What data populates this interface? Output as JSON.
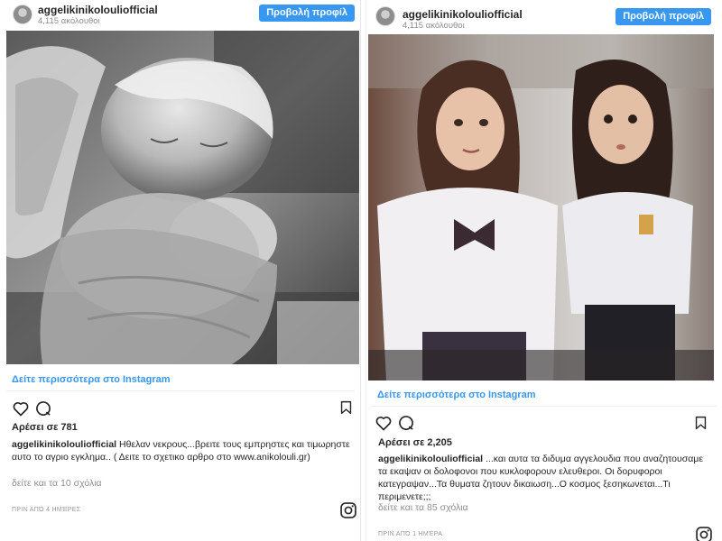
{
  "posts": [
    {
      "username": "aggelikinikolouliofficial",
      "followers": "4,115 ακόλουθοι",
      "profile_button": "Προβολή προφίλ",
      "image_subject": "angel-statue-photo",
      "more_link": "Δείτε περισσότερα στο Instagram",
      "likes": "Αρέσει σε 781",
      "caption_user": "aggelikinikolouliofficial",
      "caption_text": "Ηθελαν νεκρους...βρειτε τους εμπρηστες και τιμωρηστε αυτο το αγριο εγκλημα.. ( Δειτε το σχετικο αρθρο στο www.anikolouli.gr)",
      "comments": "δείτε και τα 10 σχόλια",
      "timestamp": "ΠΡΙΝ ΑΠΌ 4 ΗΜΈΡΕΣ"
    },
    {
      "username": "aggelikinikolouliofficial",
      "followers": "4,115 ακόλουθοι",
      "profile_button": "Προβολή προφίλ",
      "image_subject": "twin-girls-photo",
      "more_link": "Δείτε περισσότερα στο Instagram",
      "likes": "Αρέσει σε 2,205",
      "caption_user": "aggelikinikolouliofficial",
      "caption_text": "...και αυτα τα διδυμα αγγελουδια που αναζητουσαμε τα εκαψαν οι δολοφονοι που κυκλοφορουν ελευθεροι. Οι δορυφοροι κατεγραψαν...Τα θυματα ζητουν δικαιωση...Ο κοσμος ξεσηκωνεται...Τι περιμενετε;;;",
      "comments": "δείτε και τα 85 σχόλια",
      "timestamp": "ΠΡΙΝ ΑΠΌ 1 ΗΜΈΡΑ"
    }
  ],
  "icons": {
    "like": "heart-icon",
    "comment": "comment-icon",
    "save": "bookmark-icon",
    "brand": "instagram-icon"
  },
  "colors": {
    "accent": "#3897f0",
    "text": "#262626",
    "muted": "#8e8e8e"
  }
}
